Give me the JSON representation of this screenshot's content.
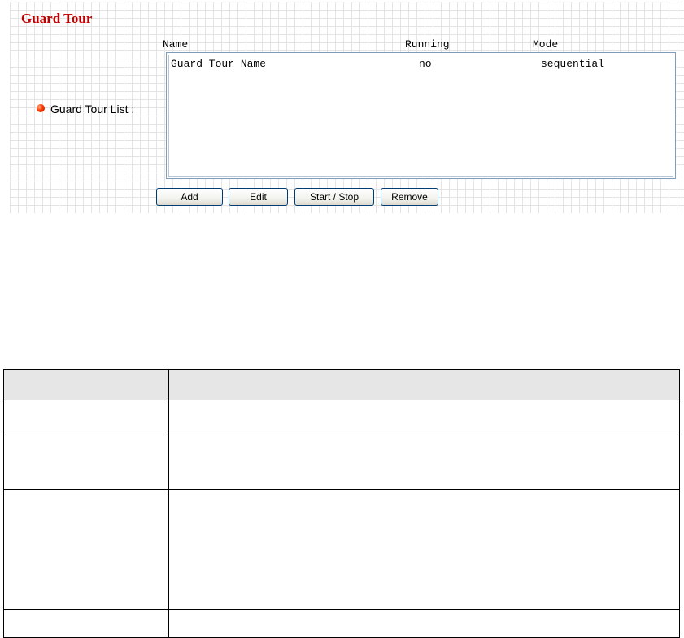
{
  "panel": {
    "title": "Guard Tour",
    "list_label": "Guard Tour List :",
    "columns": [
      "Name",
      "Running",
      "Mode"
    ],
    "rows": [
      {
        "name": "Guard Tour Name",
        "running": "no",
        "mode": "sequential"
      }
    ],
    "buttons": {
      "add": "Add",
      "edit": "Edit",
      "start_stop": "Start / Stop",
      "remove": "Remove"
    }
  },
  "doc_table": {
    "header": [
      "",
      ""
    ],
    "rows": [
      [
        "",
        ""
      ],
      [
        "",
        ""
      ],
      [
        "",
        ""
      ],
      [
        "",
        ""
      ]
    ]
  },
  "colors": {
    "title": "#c00000",
    "bullet": "#ff3a00",
    "listbox_border": "#7f9db9",
    "header_fill": "#e6e6e6"
  },
  "icons": {
    "bullet": "red-bullet-icon"
  }
}
